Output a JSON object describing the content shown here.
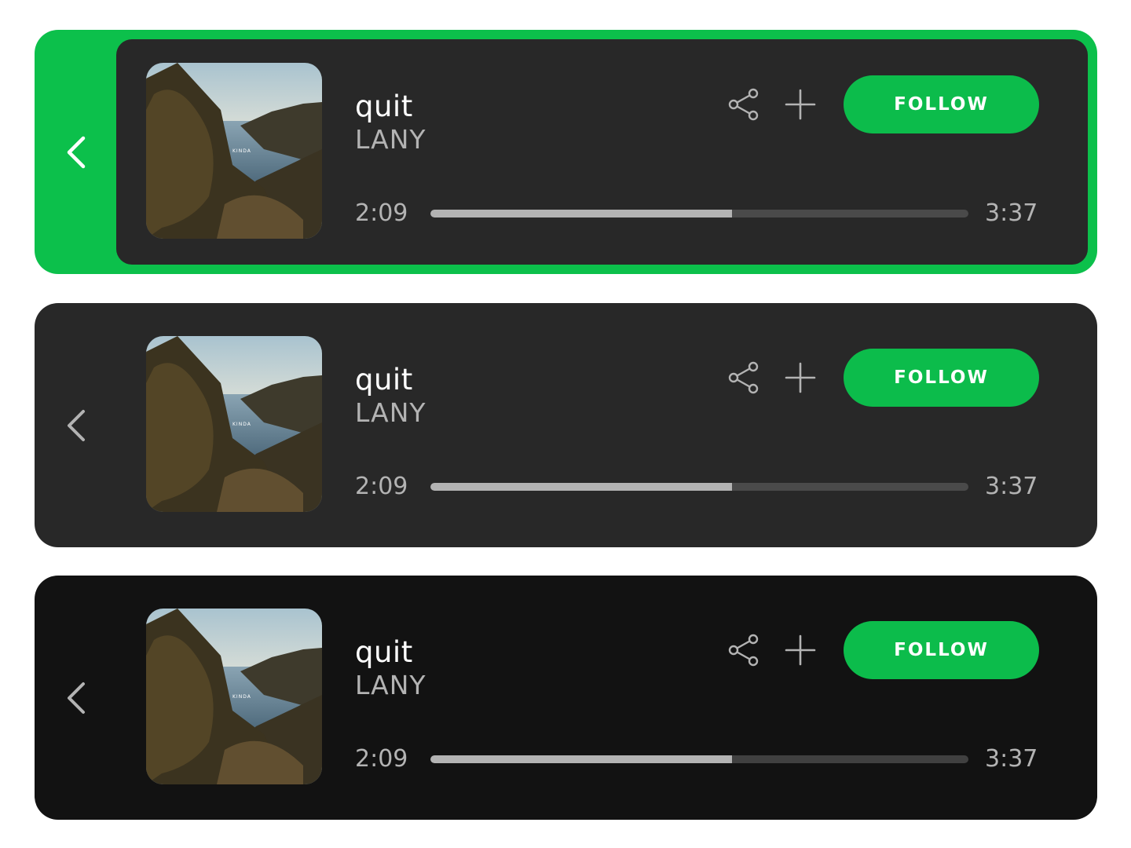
{
  "colors": {
    "accent": "#0cc04b",
    "card_mid": "#282828",
    "card_dark": "#121212",
    "text_primary": "#ffffff",
    "text_secondary": "#b3b3b3"
  },
  "icons": {
    "back": "chevron-left-icon",
    "share": "share-icon",
    "add": "plus-icon"
  },
  "cards": [
    {
      "variant": "highlight",
      "track_title": "quit",
      "artist": "LANY",
      "follow_label": "FOLLOW",
      "elapsed": "2:09",
      "duration": "3:37",
      "progress": 0.56,
      "album_art_text": "KINDA"
    },
    {
      "variant": "mid",
      "track_title": "quit",
      "artist": "LANY",
      "follow_label": "FOLLOW",
      "elapsed": "2:09",
      "duration": "3:37",
      "progress": 0.56,
      "album_art_text": "KINDA"
    },
    {
      "variant": "dark",
      "track_title": "quit",
      "artist": "LANY",
      "follow_label": "FOLLOW",
      "elapsed": "2:09",
      "duration": "3:37",
      "progress": 0.56,
      "album_art_text": "KINDA"
    }
  ]
}
